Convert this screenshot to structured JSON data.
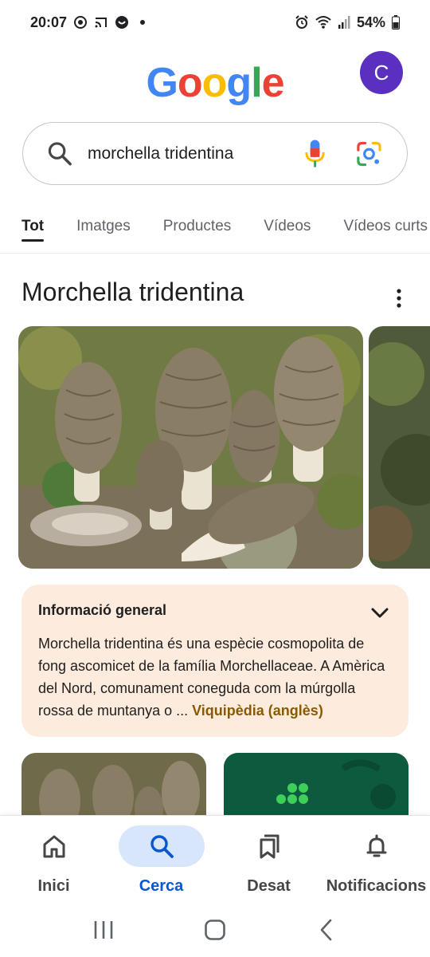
{
  "status_bar": {
    "time": "20:07",
    "battery": "54%"
  },
  "header": {
    "logo_letters": [
      "G",
      "o",
      "o",
      "g",
      "l",
      "e"
    ],
    "logo_colors": [
      "#4285F4",
      "#EA4335",
      "#FBBC05",
      "#4285F4",
      "#34A853",
      "#EA4335"
    ],
    "avatar_letter": "C",
    "avatar_color": "#5b2fc0"
  },
  "search": {
    "query": "morchella tridentina"
  },
  "tabs": [
    {
      "label": "Tot",
      "active": true
    },
    {
      "label": "Imatges",
      "active": false
    },
    {
      "label": "Productes",
      "active": false
    },
    {
      "label": "Vídeos",
      "active": false
    },
    {
      "label": "Vídeos curts",
      "active": false
    }
  ],
  "entity": {
    "title": "Morchella tridentina"
  },
  "info_card": {
    "title": "Informació general",
    "text": "Morchella tridentina és una espècie cosmopolita de fong ascomicet de la família Morchellaceae. A Amèrica del Nord, comunament coneguda com la múrgolla rossa de muntanya o ... ",
    "link": "Viquipèdia (anglès)"
  },
  "bottom_nav": [
    {
      "label": "Inici",
      "icon": "home-icon",
      "active": false
    },
    {
      "label": "Cerca",
      "icon": "search-icon",
      "active": true
    },
    {
      "label": "Desat",
      "icon": "bookmarks-icon",
      "active": false
    },
    {
      "label": "Notificacions",
      "icon": "bell-icon",
      "active": false
    }
  ],
  "colors": {
    "accent": "#0b57d0",
    "info_card_bg": "#fdebdd",
    "link": "#8a5a00"
  }
}
